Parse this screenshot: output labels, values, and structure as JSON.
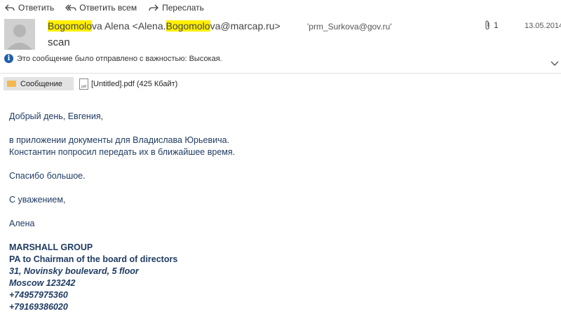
{
  "toolbar": {
    "reply": "Ответить",
    "reply_all": "Ответить всем",
    "forward": "Переслать"
  },
  "header": {
    "from_hl1": "Bogomolo",
    "from_rest1": "va Alena <Alena.",
    "from_hl2": "Bogomolo",
    "from_rest2": "va@marcap.ru>",
    "to": "'prm_Surkova@gov.ru'",
    "attachment_count": "1",
    "date": "13.05.2014",
    "subject": "scan",
    "importance_note": "Это сообщение было отправлено с важностью: Высокая."
  },
  "tabs": {
    "message_label": "Сообщение",
    "attachment_label": "[Untitled].pdf (425 Кбайт)"
  },
  "body": {
    "greeting": "Добрый день, Евгения,",
    "line1": "в приложении документы для Владислава Юрьевича.",
    "line2": "Константин попросил передать их в ближайшее время.",
    "thanks": "Спасибо большое.",
    "regards": "С уважением,",
    "name": "Алена",
    "sig_company": "MARSHALL GROUP",
    "sig_title": "PA to Chairman of the board of directors",
    "sig_address": "31, Novinsky boulevard, 5 floor",
    "sig_city": "Moscow 123242",
    "sig_phone1": "+74957975360",
    "sig_phone2": "+79169386020"
  },
  "colors": {
    "highlight": "#ffef00",
    "body_text": "#1f3b63",
    "info_icon": "#1f5fa8"
  }
}
